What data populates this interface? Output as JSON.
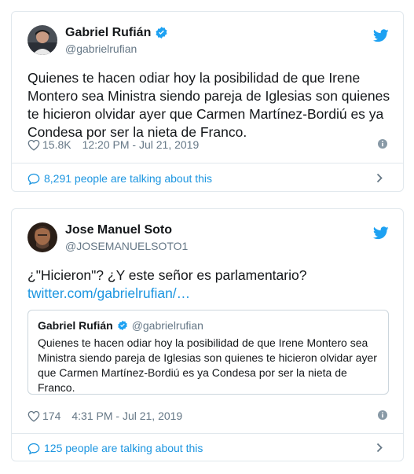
{
  "tweets": [
    {
      "author_name": "Gabriel Rufián",
      "author_handle": "@gabrielrufian",
      "verified": true,
      "text": "Quienes te hacen odiar hoy la posibilidad de que Irene Montero sea Ministra siendo pareja de Iglesias son quienes te hicieron olvidar ayer que Carmen Martínez-Bordiú es ya Condesa por ser la nieta de Franco.",
      "likes": "15.8K",
      "timestamp": "12:20 PM - Jul 21, 2019",
      "talking": "8,291 people are talking about this"
    },
    {
      "author_name": "Jose Manuel Soto",
      "author_handle": "@JOSEMANUELSOTO1",
      "verified": false,
      "text": "¿\"Hicieron\"? ¿Y este señor es parlamentario?",
      "link": "twitter.com/gabrielrufian/…",
      "quoted": {
        "author_name": "Gabriel Rufián",
        "author_handle": "@gabrielrufian",
        "text": "Quienes te hacen odiar hoy la posibilidad de que Irene Montero sea Ministra siendo pareja de Iglesias son quienes te hicieron olvidar ayer que Carmen Martínez-Bordiú es ya Condesa por ser la nieta de Franco."
      },
      "likes": "174",
      "timestamp": "4:31 PM - Jul 21, 2019",
      "talking": "125 people are talking about this"
    }
  ],
  "colors": {
    "twitter_blue": "#1da1f2",
    "link_blue": "#1b95e0",
    "muted": "#657786",
    "border": "#e1e8ed"
  },
  "icons": [
    "twitter-bird-icon",
    "verified-badge-icon",
    "heart-icon",
    "info-icon",
    "comment-bubble-icon",
    "chevron-right-icon"
  ]
}
